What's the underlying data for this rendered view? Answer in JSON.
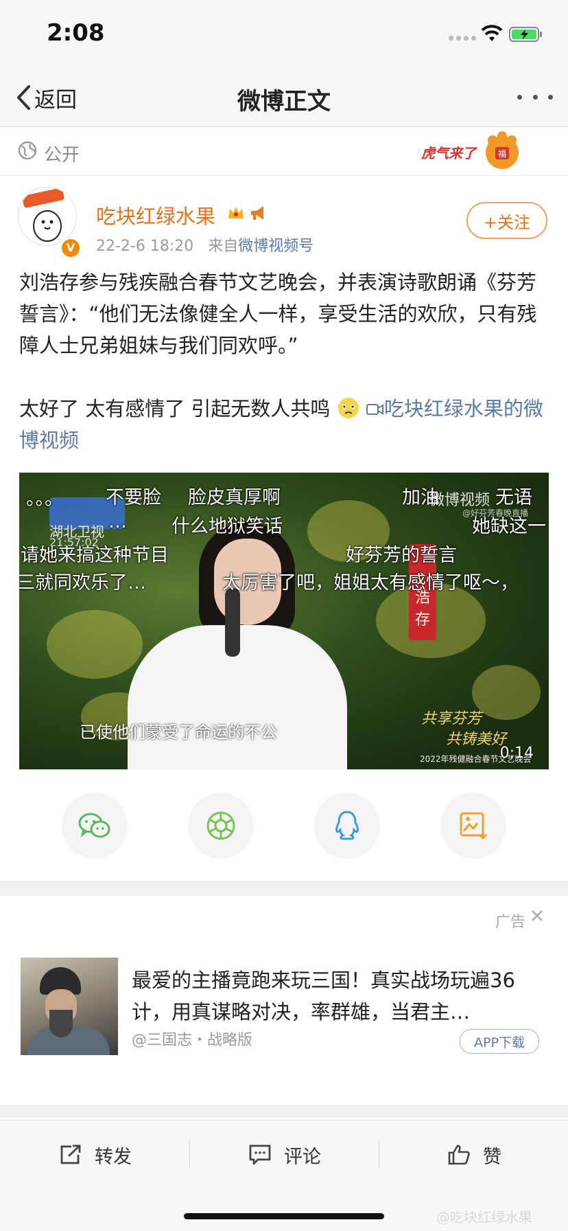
{
  "status": {
    "time": "2:08"
  },
  "nav": {
    "back_label": "返回",
    "title": "微博正文"
  },
  "visibility": {
    "label": "公开"
  },
  "user": {
    "name": "吃块红绿水果",
    "time": "22-2-6 18:20",
    "source_prefix": "来自",
    "source": "微博视频号",
    "follow_label": "+关注",
    "verified_mark": "V"
  },
  "post": {
    "line1": "刘浩存参与残疾融合春节文艺晚会，并表演诗歌朗诵《芬芳誓言》：“他们无法像健全人一样，享受生活的欢欣，只有残障人士兄弟姐妹与我们同欢呼。”",
    "line2": "太好了 太有感情了 引起无数人共鸣",
    "video_link": "吃块红绿水果的微博视频"
  },
  "video": {
    "danmaku": [
      "。。。",
      "不要脸",
      "脸皮真厚啊",
      "加油",
      "无语",
      "…",
      "什么地狱笑话",
      "她缺这一",
      "请她来搞这种节目",
      "好芬芳的誓言",
      "三就同欢乐了…",
      "太厉害了吧，姐姐太有感情了呕～，"
    ],
    "channel_logo": "湖北卫视",
    "clock": "21:57:02",
    "watermark": "微博视频",
    "watermark_sub": "@好芬芳春晚直播",
    "subtitle": "已使他们蒙受了命运的不公",
    "banner": "浩存",
    "stage_line1": "共享芬芳",
    "stage_line2": "共铸美好",
    "stage_small": "2022年残健融合春节文艺晚会",
    "duration": "0:14"
  },
  "share": {
    "items": [
      {
        "icon": "wechat-icon"
      },
      {
        "icon": "moments-icon"
      },
      {
        "icon": "qq-icon"
      },
      {
        "icon": "save-image-icon"
      }
    ],
    "colors": {
      "wechat": "#5bb85d",
      "moments": "#7ac15a",
      "qq": "#3a9be0",
      "save": "#f0a030"
    }
  },
  "ad": {
    "label": "广告",
    "title": "最爱的主播竟跑来玩三国！真实战场玩遍36计，用真谋略对决，率群雄，当君主…",
    "source": "@三国志・战略版",
    "button": "APP下载"
  },
  "actions": {
    "repost": "转发",
    "comment": "评论",
    "like": "赞"
  },
  "badges": {
    "tiger": "虎气来了"
  },
  "colors": {
    "accent": "#e3731b",
    "link": "#5b7aa8",
    "muted": "#9a9a9a"
  },
  "bottom_watermark": "@吃块红绿水果"
}
